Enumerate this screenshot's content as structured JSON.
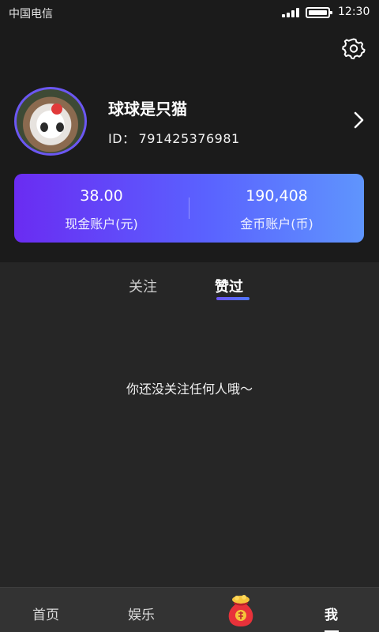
{
  "status_bar": {
    "carrier": "中国电信",
    "time": "12:30"
  },
  "profile": {
    "name": "球球是只猫",
    "id_label": "ID：",
    "id_value": "791425376981"
  },
  "wallet": {
    "cash": {
      "amount": "38.00",
      "label": "现金账户(元)"
    },
    "coins": {
      "amount": "190,408",
      "label": "金币账户(币)"
    }
  },
  "tabs": [
    {
      "label": "关注",
      "active": false
    },
    {
      "label": "赞过",
      "active": true
    }
  ],
  "empty_message": "你还没关注任何人哦～",
  "bottom_nav": [
    {
      "label": "首页"
    },
    {
      "label": "娱乐"
    },
    {
      "label": "",
      "icon": "red-lucky-bag-icon"
    },
    {
      "label": "我",
      "active": true
    }
  ],
  "colors": {
    "card_gradient_start": "#6a2cf2",
    "card_gradient_end": "#5f95fd",
    "avatar_ring": "#6b57f2",
    "tab_underline": "#5f6bf8",
    "bag_red": "#e8323a"
  },
  "icons": [
    "gear-icon",
    "chevron-right-icon",
    "signal-icon",
    "battery-icon",
    "red-lucky-bag-icon"
  ]
}
